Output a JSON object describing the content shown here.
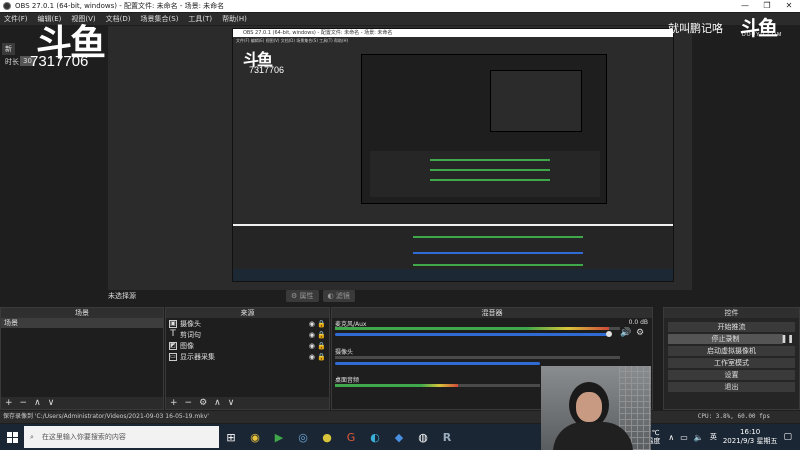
{
  "window": {
    "title": "OBS 27.0.1 (64-bit, windows) - 配置文件: 未命名 - 场景: 未命名",
    "controls": [
      "—",
      "❐",
      "✕"
    ]
  },
  "menu": [
    "文件(F)",
    "编辑(E)",
    "视图(V)",
    "文档(D)",
    "场景集合(S)",
    "工具(T)",
    "帮助(H)"
  ],
  "watermark": {
    "logo": "斗鱼",
    "room_id": "7317706",
    "slogan": "就叫鹏记咯",
    "site": "DOUYU.COM"
  },
  "overlay": {
    "new_label": "新",
    "duration_label": "时长",
    "value_label": "30"
  },
  "preview": {
    "nested_title": "OBS 27.0.1 (64-bit, windows) - 配置文件: 未命名 - 场景: 未命名",
    "nested_menu": "文件(F)  编辑(E)  视图(V)  文档(D)  场景集合(S)  工具(T)  帮助(H)",
    "nested_room_id": "7317706",
    "nested_logo": "斗鱼"
  },
  "source_bar": {
    "label": "未选择源",
    "properties": "属性",
    "filters": "滤镜"
  },
  "scenes": {
    "header": "场景",
    "items": [
      "场景"
    ],
    "footer": [
      "+",
      "−",
      "∧",
      "∨"
    ]
  },
  "sources": {
    "header": "来源",
    "items": [
      {
        "name": "摄像头",
        "icon": "camera-icon"
      },
      {
        "name": "剪词句",
        "icon": "text-icon"
      },
      {
        "name": "图像",
        "icon": "image-icon"
      },
      {
        "name": "显示器采集",
        "icon": "monitor-icon"
      }
    ],
    "footer": [
      "+",
      "−",
      "⚙",
      "∧",
      "∨"
    ]
  },
  "mixer": {
    "header": "混音器",
    "channels": [
      {
        "name": "麦克风/Aux",
        "db": "0.0 dB",
        "level": 0.96,
        "volume": 1.0
      },
      {
        "name": "摄像头",
        "db": "",
        "level": 0.0,
        "volume": 1.0
      },
      {
        "name": "桌面音频",
        "db": "",
        "level": 0.6,
        "volume": 1.0
      }
    ]
  },
  "controls": {
    "header": "控件",
    "buttons": [
      "开始推流",
      "停止录制",
      "启动虚拟摄像机",
      "工作室模式",
      "设置",
      "退出"
    ],
    "active_index": 1
  },
  "status": {
    "saved": "保存录像到 'C:/Users/Administrator/Videos/2021-09-03 16-05-19.mkv'",
    "cpu": "CPU: 3.8%, 60.00 fps"
  },
  "taskbar": {
    "search_placeholder": "在这里输入你要搜索的内容",
    "time": "16:10",
    "date": "2021/9/3 星期五",
    "lang": "英",
    "weather_temp": "5℃",
    "weather_label": "温度",
    "apps": [
      "task-view-icon",
      "chrome-icon",
      "player-icon",
      "steam-icon",
      "coin-icon",
      "g-icon",
      "edge-icon",
      "mail-icon",
      "obs-icon",
      "r-icon"
    ]
  },
  "colors": {
    "meter_green": "#3fa84a",
    "meter_yellow": "#d7c43a",
    "meter_red": "#d04a3a",
    "volume_blue": "#2f6bd3"
  }
}
